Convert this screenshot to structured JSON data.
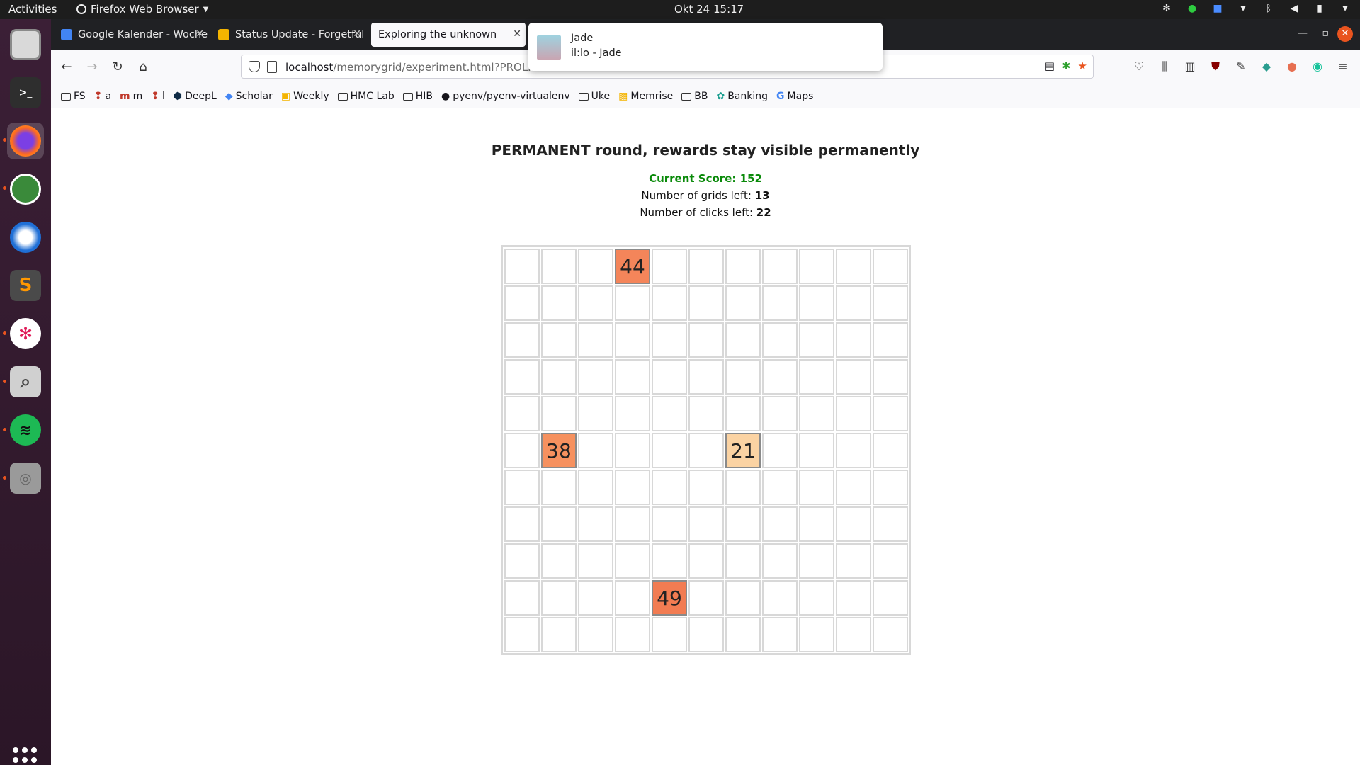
{
  "topbar": {
    "activities": "Activities",
    "app_name": "Firefox Web Browser",
    "clock": "Okt 24  15:17"
  },
  "dock": {
    "apps": [
      "Files",
      "Terminal",
      "Firefox",
      "Inkscape",
      "Thunderbird",
      "Sublime Text",
      "Slack",
      "Image Viewer",
      "Spotify",
      "Disk"
    ]
  },
  "tabs": [
    {
      "label": "Google Kalender - Woche",
      "color": "#4285f4"
    },
    {
      "label": "Status Update - Forgetful",
      "color": "#f4b400"
    },
    {
      "label": "Exploring the unknown",
      "color": ""
    }
  ],
  "url": {
    "host": "localhost",
    "path": "/memorygrid/experiment.html?PROLIFIC"
  },
  "bookmarks": [
    "FS",
    "a",
    "m",
    "l",
    "DeepL",
    "Scholar",
    "Weekly",
    "HMC Lab",
    "HIB",
    "pyenv/pyenv-virtualenv",
    "Uke",
    "Memrise",
    "BB",
    "Banking",
    "Maps"
  ],
  "notification": {
    "title": "Jade",
    "body": "il:lo - Jade"
  },
  "page": {
    "headline": "PERMANENT round, rewards stay visible permanently",
    "score_label": "Current Score: 152",
    "grids_left_label": "Number of grids left: ",
    "grids_left": "13",
    "clicks_left_label": "Number of clicks left: ",
    "clicks_left": "22"
  },
  "grid": {
    "rows": 11,
    "cols": 11,
    "revealed": [
      {
        "row": 0,
        "col": 3,
        "value": 44,
        "color": "#f4855a"
      },
      {
        "row": 5,
        "col": 1,
        "value": 38,
        "color": "#f6915f"
      },
      {
        "row": 5,
        "col": 6,
        "value": 21,
        "color": "#fbd3a3"
      },
      {
        "row": 9,
        "col": 4,
        "value": 49,
        "color": "#f27c52"
      }
    ]
  }
}
